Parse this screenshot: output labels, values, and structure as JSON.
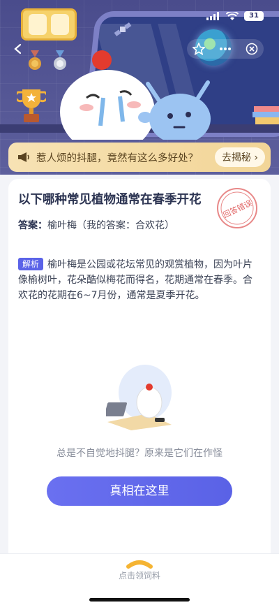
{
  "status_bar": {
    "battery": "31"
  },
  "promo": {
    "text": "惹人烦的抖腿，竟然有这么多好处？",
    "button": "去揭秘"
  },
  "question": {
    "title": "以下哪种常见植物通常在春季开花",
    "stamp": "回答错误",
    "answer_label": "答案：",
    "answer_value": "榆叶梅（我的答案：合欢花）",
    "analysis_tag": "解析",
    "analysis_text": "榆叶梅是公园或花坛常见的观赏植物，因为叶片像榆树叶，花朵酷似梅花而得名，花期通常在春季。合欢花的花期在6~7月份，通常是夏季开花。",
    "subtitle": "总是不自觉地抖腿？原来是它们在作怪",
    "cta": "真相在这里"
  },
  "bottom_bar": {
    "label": "点击领饲料"
  },
  "colors": {
    "accent": "#5b63e8",
    "scene_bg": "#4a4c8c",
    "stamp": "#e26a6a"
  }
}
